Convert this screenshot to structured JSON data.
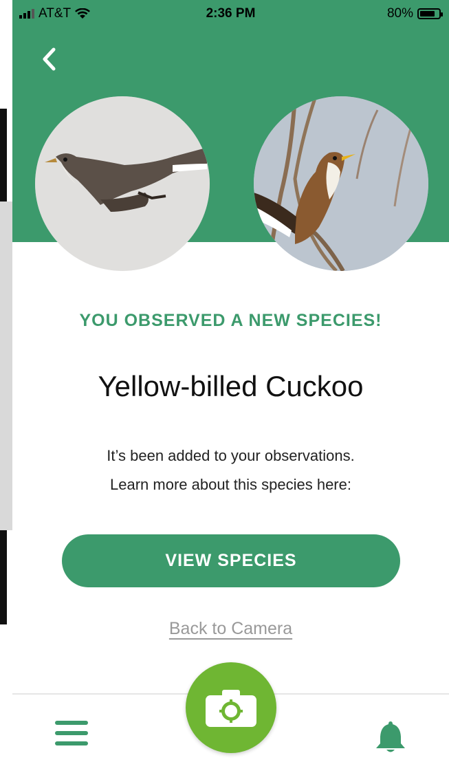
{
  "status_bar": {
    "carrier": "AT&T",
    "time": "2:36 PM",
    "battery": "80%"
  },
  "observation": {
    "headline": "YOU OBSERVED A NEW SPECIES!",
    "species_name": "Yellow-billed Cuckoo",
    "description_line1": "It’s been added to your observations.",
    "description_line2": "Learn more about this species here:"
  },
  "actions": {
    "view_species_label": "VIEW SPECIES",
    "back_to_camera_label": "Back to Camera"
  },
  "icons": {
    "back": "chevron-left-icon",
    "menu": "hamburger-menu-icon",
    "camera": "camera-icon",
    "notifications": "bell-icon"
  },
  "colors": {
    "brand_green": "#3c9a6c",
    "camera_green": "#6fb633",
    "link_gray": "#999999"
  }
}
